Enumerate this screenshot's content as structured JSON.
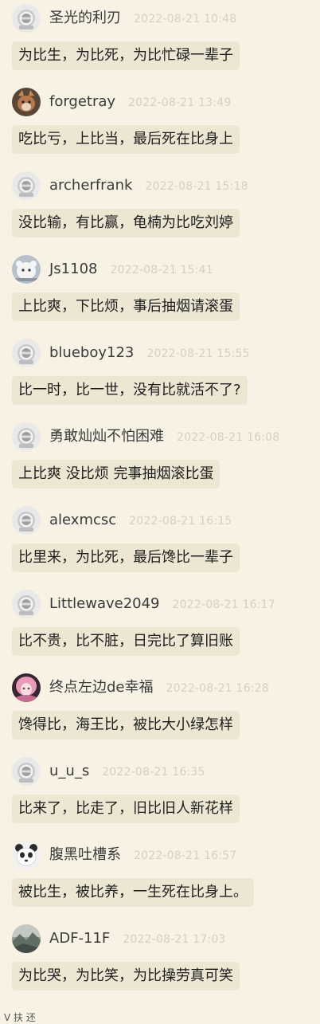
{
  "comments": [
    {
      "username": "圣光的利刃",
      "time": "2022-08-21 10:48",
      "text": "为比生，为比死，为比忙碌一辈子",
      "avatar": "helmet-avatar"
    },
    {
      "username": "forgetray",
      "time": "2022-08-21 13:49",
      "text": "吃比亏，上比当，最后死在比身上",
      "avatar": "cat-avatar"
    },
    {
      "username": "archerfrank",
      "time": "2022-08-21 15:18",
      "text": "没比输，有比赢，龟楠为比吃刘婷",
      "avatar": "helmet-avatar"
    },
    {
      "username": "Js1108",
      "time": "2022-08-21 15:41",
      "text": "上比爽，下比烦，事后抽烟请滚蛋",
      "avatar": "white-animal-avatar"
    },
    {
      "username": "blueboy123",
      "time": "2022-08-21 15:55",
      "text": "比一时，比一世，没有比就活不了?",
      "avatar": "helmet-avatar"
    },
    {
      "username": "勇敢灿灿不怕困难",
      "time": "2022-08-21 16:08",
      "text": "上比爽 没比烦 完事抽烟滚比蛋",
      "avatar": "helmet-avatar"
    },
    {
      "username": "alexmcsc",
      "time": "2022-08-21 16:15",
      "text": "比里来，为比死，最后馋比一辈子",
      "avatar": "helmet-avatar"
    },
    {
      "username": "Littlewave2049",
      "time": "2022-08-21 16:17",
      "text": "比不贵，比不脏，日完比了算旧账",
      "avatar": "helmet-avatar"
    },
    {
      "username": "终点左边de幸福",
      "time": "2022-08-21 16:28",
      "text": "馋得比，海王比，被比大小绿怎样",
      "avatar": "anime-pink-avatar"
    },
    {
      "username": "u_u_s",
      "time": "2022-08-21 16:35",
      "text": "比来了，比走了，旧比旧人新花样",
      "avatar": "helmet-avatar"
    },
    {
      "username": "腹黑吐槽系",
      "time": "2022-08-21 16:57",
      "text": "被比生，被比养，一生死在比身上。",
      "avatar": "panda-avatar"
    },
    {
      "username": "ADF-11F",
      "time": "2022-08-21 17:03",
      "text": "为比哭，为比笑，为比操劳真可笑",
      "avatar": "landscape-avatar"
    }
  ],
  "bottom_hint": "V 扶 还"
}
